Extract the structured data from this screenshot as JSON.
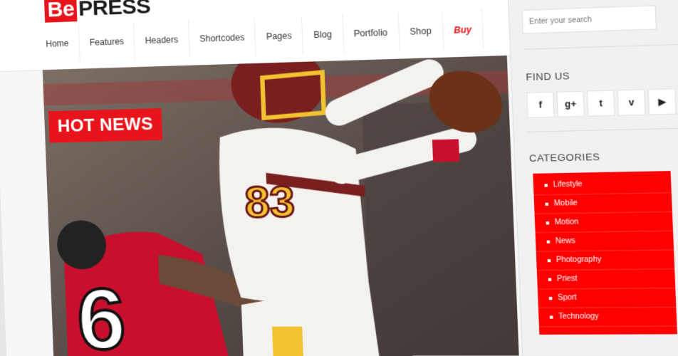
{
  "logo": {
    "part1": "Be",
    "part2": "PRESS"
  },
  "nav": [
    {
      "label": "Home"
    },
    {
      "label": "Features"
    },
    {
      "label": "Headers"
    },
    {
      "label": "Shortcodes"
    },
    {
      "label": "Pages"
    },
    {
      "label": "Blog"
    },
    {
      "label": "Portfolio"
    },
    {
      "label": "Shop"
    },
    {
      "label": "Buy"
    }
  ],
  "hero": {
    "badge": "HOT NEWS",
    "jersey_front": "83",
    "jersey_back": "6"
  },
  "sidebar": {
    "search_placeholder": "Enter your search",
    "find_us_title": "FIND US",
    "social": [
      {
        "icon": "facebook-icon",
        "glyph": "f"
      },
      {
        "icon": "google-plus-icon",
        "glyph": "g+"
      },
      {
        "icon": "twitter-icon",
        "glyph": "t"
      },
      {
        "icon": "vimeo-icon",
        "glyph": "v"
      },
      {
        "icon": "youtube-icon",
        "glyph": "▶"
      }
    ],
    "categories_title": "CATEGORIES",
    "categories": [
      {
        "label": "Lifestyle"
      },
      {
        "label": "Mobile"
      },
      {
        "label": "Motion"
      },
      {
        "label": "News"
      },
      {
        "label": "Photography"
      },
      {
        "label": "Priest"
      },
      {
        "label": "Sport"
      },
      {
        "label": "Technology"
      }
    ]
  },
  "colors": {
    "accent": "#e8141b",
    "category_bg": "#ff0000"
  }
}
